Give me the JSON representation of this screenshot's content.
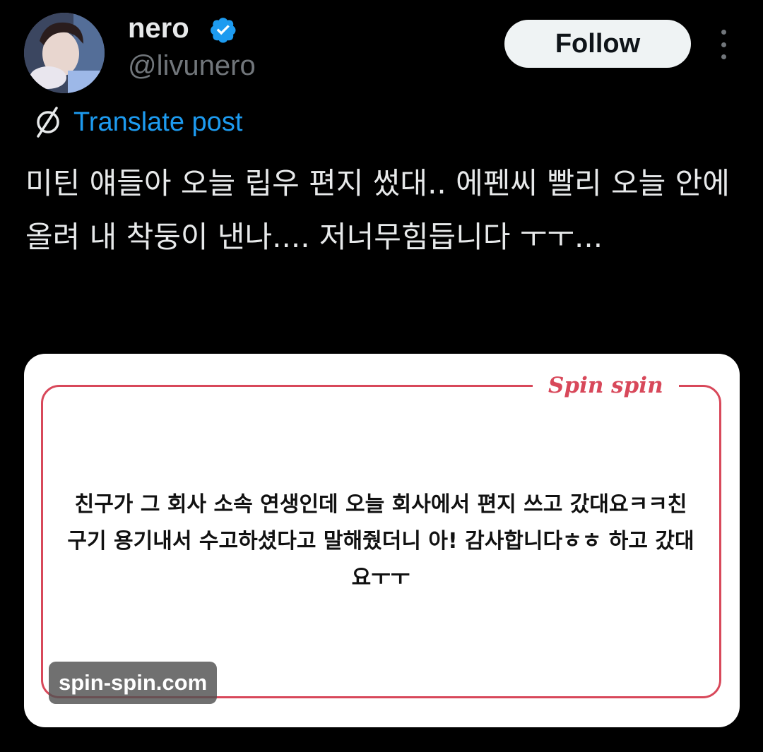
{
  "author": {
    "display_name": "nero",
    "handle": "@livunero",
    "verified": true
  },
  "header": {
    "follow_label": "Follow"
  },
  "translate": {
    "label": "Translate post"
  },
  "post": {
    "text": "미틴 얘들아 오늘 립우 편지 썼대.. 에펜씨 빨리 오늘 안에 올려 내 착둥이 낸나.... 저너무힘듭니다 ㅜㅜ..."
  },
  "media": {
    "brand_logo": "Spin spin",
    "letter_text": "친구가 그 회사 소속 연생인데 오늘 회사에서 편지 쓰고 갔대요ㅋㅋ친구기 용기내서 수고하셨다고 말해줬더니 아! 감사합니다ㅎㅎ 하고 갔대요ㅜㅜ",
    "watermark": "spin-spin.com"
  },
  "colors": {
    "background": "#000000",
    "text_primary": "#e7e9ea",
    "text_secondary": "#71767b",
    "link": "#1d9bf0",
    "verified_badge": "#1d9bf0",
    "card_border": "#d8485a"
  },
  "icons": {
    "verified": "verified-badge-icon",
    "translate": "globe-icon",
    "more": "more-options-icon"
  }
}
